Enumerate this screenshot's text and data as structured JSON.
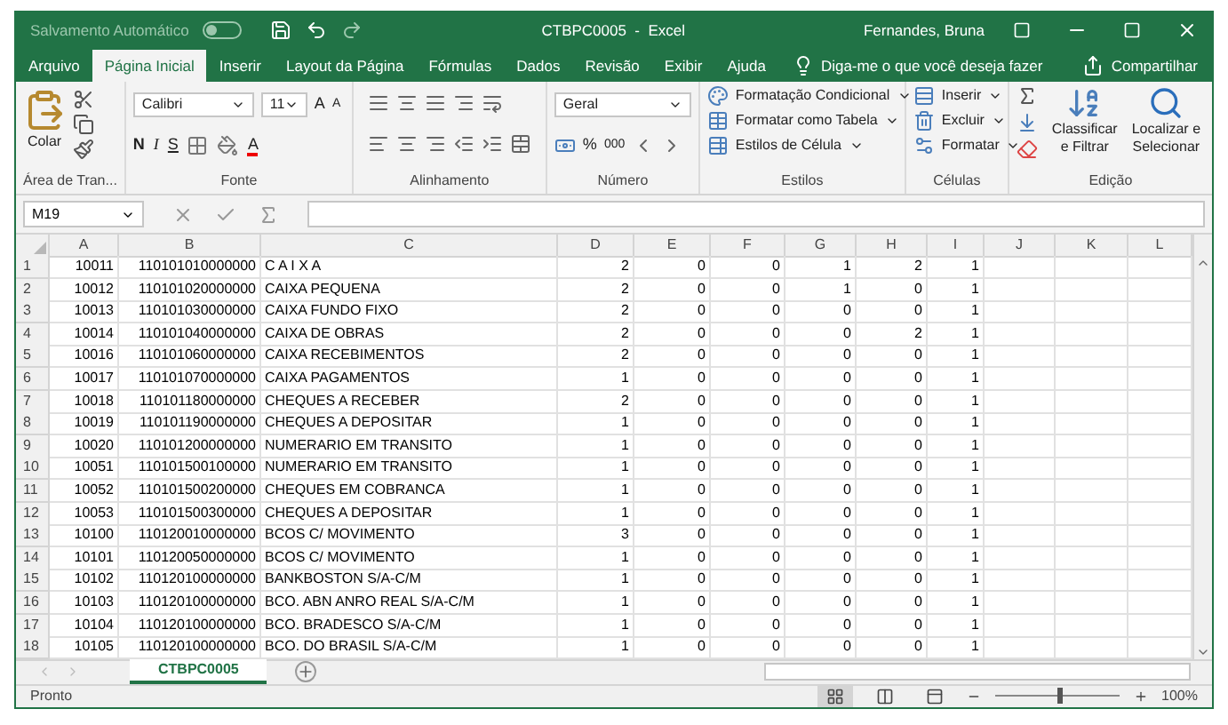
{
  "title_bar": {
    "autosave_label": "Salvamento Automático",
    "autosave_on": false,
    "title": "CTBPC0005  -  Excel",
    "user": "Fernandes, Bruna"
  },
  "ribbon_tabs": [
    {
      "label": "Arquivo",
      "selected": false
    },
    {
      "label": "Página Inicial",
      "selected": true
    },
    {
      "label": "Inserir",
      "selected": false
    },
    {
      "label": "Layout da Página",
      "selected": false
    },
    {
      "label": "Fórmulas",
      "selected": false
    },
    {
      "label": "Dados",
      "selected": false
    },
    {
      "label": "Revisão",
      "selected": false
    },
    {
      "label": "Exibir",
      "selected": false
    },
    {
      "label": "Ajuda",
      "selected": false
    }
  ],
  "tell_me": "Diga-me o que você deseja fazer",
  "share": "Compartilhar",
  "clipboard": {
    "paste": "Colar",
    "label": "Área de Tran..."
  },
  "font": {
    "name": "Calibri",
    "size": "11",
    "grow": "A",
    "shrink": "A",
    "bold": "N",
    "italic": "I",
    "underline": "S",
    "color_letter": "A",
    "label": "Fonte"
  },
  "alignment": {
    "label": "Alinhamento"
  },
  "number": {
    "format": "Geral",
    "percent": "%",
    "thousands": "000",
    "label": "Número"
  },
  "styles": {
    "items": [
      "Formatação Condicional",
      "Formatar como Tabela",
      "Estilos de Célula"
    ],
    "label": "Estilos"
  },
  "cells_group": {
    "items": [
      "Inserir",
      "Excluir",
      "Formatar"
    ],
    "label": "Células"
  },
  "editing": {
    "sort": [
      "Classificar",
      "e Filtrar"
    ],
    "find": [
      "Localizar e",
      "Selecionar"
    ],
    "label": "Edição"
  },
  "formula_bar": {
    "name_box": "M19"
  },
  "columns": [
    "A",
    "B",
    "C",
    "D",
    "E",
    "F",
    "G",
    "H",
    "I",
    "J",
    "K",
    "L"
  ],
  "rows": [
    {
      "row": "1",
      "cells": [
        "10011",
        "110101010000000",
        "C A I X A",
        "2",
        "0",
        "0",
        "1",
        "2",
        "1"
      ]
    },
    {
      "row": "2",
      "cells": [
        "10012",
        "110101020000000",
        "CAIXA PEQUENA",
        "2",
        "0",
        "0",
        "1",
        "0",
        "1"
      ]
    },
    {
      "row": "3",
      "cells": [
        "10013",
        "110101030000000",
        "CAIXA FUNDO FIXO",
        "2",
        "0",
        "0",
        "0",
        "0",
        "1"
      ]
    },
    {
      "row": "4",
      "cells": [
        "10014",
        "110101040000000",
        "CAIXA DE OBRAS",
        "2",
        "0",
        "0",
        "0",
        "2",
        "1"
      ]
    },
    {
      "row": "5",
      "cells": [
        "10016",
        "110101060000000",
        "CAIXA RECEBIMENTOS",
        "2",
        "0",
        "0",
        "0",
        "0",
        "1"
      ]
    },
    {
      "row": "6",
      "cells": [
        "10017",
        "110101070000000",
        "CAIXA PAGAMENTOS",
        "1",
        "0",
        "0",
        "0",
        "0",
        "1"
      ]
    },
    {
      "row": "7",
      "cells": [
        "10018",
        "110101180000000",
        "CHEQUES A RECEBER",
        "2",
        "0",
        "0",
        "0",
        "0",
        "1"
      ]
    },
    {
      "row": "8",
      "cells": [
        "10019",
        "110101190000000",
        "CHEQUES A DEPOSITAR",
        "1",
        "0",
        "0",
        "0",
        "0",
        "1"
      ]
    },
    {
      "row": "9",
      "cells": [
        "10020",
        "110101200000000",
        "NUMERARIO EM TRANSITO",
        "1",
        "0",
        "0",
        "0",
        "0",
        "1"
      ]
    },
    {
      "row": "10",
      "cells": [
        "10051",
        "110101500100000",
        "NUMERARIO EM TRANSITO",
        "1",
        "0",
        "0",
        "0",
        "0",
        "1"
      ]
    },
    {
      "row": "11",
      "cells": [
        "10052",
        "110101500200000",
        "CHEQUES EM COBRANCA",
        "1",
        "0",
        "0",
        "0",
        "0",
        "1"
      ]
    },
    {
      "row": "12",
      "cells": [
        "10053",
        "110101500300000",
        "CHEQUES A DEPOSITAR",
        "1",
        "0",
        "0",
        "0",
        "0",
        "1"
      ]
    },
    {
      "row": "13",
      "cells": [
        "10100",
        "110120010000000",
        "BCOS C/ MOVIMENTO",
        "3",
        "0",
        "0",
        "0",
        "0",
        "1"
      ]
    },
    {
      "row": "14",
      "cells": [
        "10101",
        "110120050000000",
        "BCOS C/ MOVIMENTO",
        "1",
        "0",
        "0",
        "0",
        "0",
        "1"
      ]
    },
    {
      "row": "15",
      "cells": [
        "10102",
        "110120100000000",
        "BANKBOSTON S/A-C/M",
        "1",
        "0",
        "0",
        "0",
        "0",
        "1"
      ]
    },
    {
      "row": "16",
      "cells": [
        "10103",
        "110120100000000",
        "BCO. ABN ANRO REAL S/A-C/M",
        "1",
        "0",
        "0",
        "0",
        "0",
        "1"
      ]
    },
    {
      "row": "17",
      "cells": [
        "10104",
        "110120100000000",
        "BCO. BRADESCO S/A-C/M",
        "1",
        "0",
        "0",
        "0",
        "0",
        "1"
      ]
    },
    {
      "row": "18",
      "cells": [
        "10105",
        "110120100000000",
        "BCO. DO BRASIL S/A-C/M",
        "1",
        "0",
        "0",
        "0",
        "0",
        "1"
      ]
    }
  ],
  "sheet_tabs": [
    {
      "label": "CTBPC0005",
      "selected": true
    }
  ],
  "status_bar": {
    "status": "Pronto",
    "view_buttons": [
      {
        "kind": "normal",
        "selected": true
      },
      {
        "kind": "page-layout",
        "selected": false
      },
      {
        "kind": "page-break",
        "selected": false
      }
    ],
    "zoom_slider": {
      "level": 0.5
    },
    "zoom": "100%"
  }
}
